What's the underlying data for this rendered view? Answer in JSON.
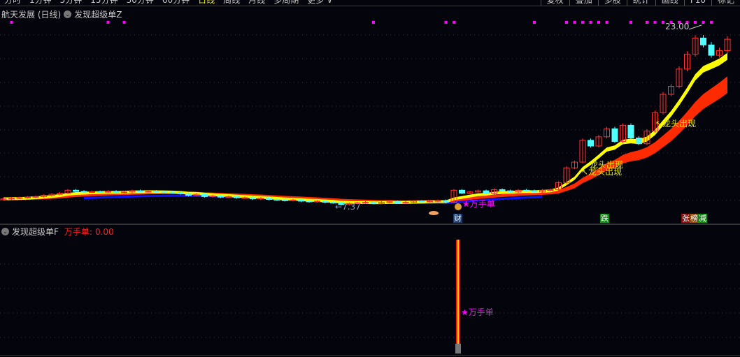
{
  "toolbar": {
    "periods": [
      "分时",
      "1分钟",
      "5分钟",
      "15分钟",
      "30分钟",
      "60分钟",
      "日线",
      "周线",
      "月线",
      "多周期",
      "更多 ∨"
    ],
    "active_period": "日线",
    "buttons": [
      "复权",
      "叠加",
      "多股",
      "统计",
      "画线",
      "F10",
      "标记"
    ]
  },
  "main_panel": {
    "stock_title": "航天发展 (日线)",
    "indicator": "发现超级单Z",
    "high_label": "23.00",
    "low_label": "7.37",
    "wanshoudan_label": "★万手单",
    "longtou_labels": [
      "龙头出现",
      "龙头出现",
      "龙头出现"
    ],
    "markers": {
      "cai": "财",
      "die": "跌",
      "zhang": "张",
      "bang": "榜",
      "jian": "减"
    }
  },
  "sub_panel": {
    "indicator": "发现超级单F",
    "value_label": "万手单:",
    "value": "0.00",
    "bar_label": "★万手单"
  },
  "colors": {
    "up": "#ff3030",
    "down": "#50ffff",
    "ma_fast": "#ffff00",
    "ma_slow": "#ff2a00",
    "ma_blue": "#1010ff",
    "signal": "#ff00ff",
    "label": "#e8e800"
  },
  "chart_data": {
    "type": "candlestick",
    "price_range": [
      7.37,
      23.0
    ],
    "closes": [
      8.0,
      8.05,
      8.1,
      8.15,
      8.2,
      8.3,
      8.4,
      8.5,
      8.75,
      8.65,
      8.6,
      8.62,
      8.6,
      8.65,
      8.55,
      8.6,
      8.7,
      8.62,
      8.66,
      8.6,
      8.58,
      8.55,
      8.45,
      8.3,
      8.4,
      8.2,
      8.25,
      8.15,
      8.2,
      8.1,
      8.1,
      8.0,
      8.05,
      7.95,
      7.9,
      7.85,
      7.9,
      7.8,
      7.75,
      7.8,
      7.7,
      7.65,
      7.5,
      7.6,
      7.65,
      7.7,
      7.6,
      7.7,
      7.75,
      7.65,
      7.7,
      7.8,
      7.75,
      7.8,
      7.85,
      7.7,
      8.75,
      8.5,
      8.6,
      8.7,
      8.5,
      8.8,
      8.7,
      8.6,
      8.75,
      8.7,
      8.6,
      8.75,
      8.8,
      9.4,
      10.7,
      11.2,
      13.1,
      12.6,
      13.4,
      14.1,
      13.0,
      14.4,
      13.3,
      12.8,
      13.9,
      15.5,
      17.1,
      17.8,
      19.3,
      20.6,
      22.0,
      21.4,
      20.5,
      20.9,
      21.9
    ],
    "signal_dot_indices": [
      1,
      13,
      15,
      46,
      55,
      56,
      66,
      70,
      71,
      72,
      73,
      74,
      75,
      78,
      80,
      81,
      82,
      83,
      84,
      85,
      86,
      87,
      88
    ]
  }
}
